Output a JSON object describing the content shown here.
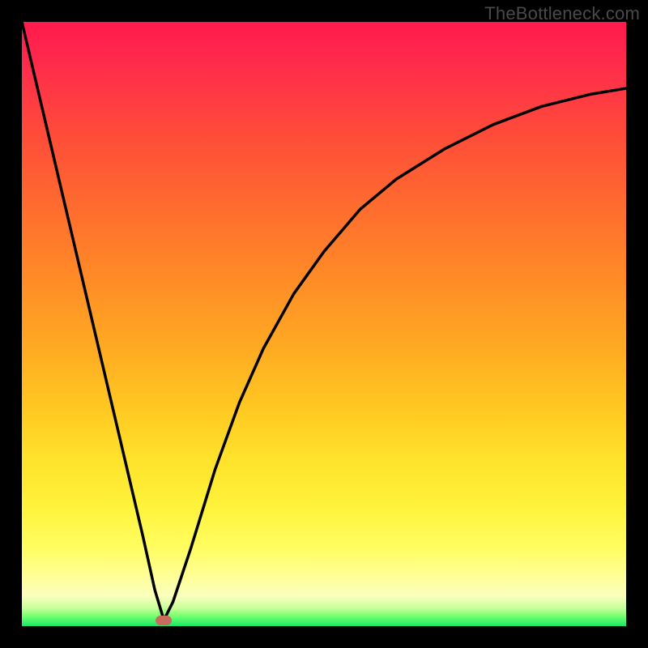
{
  "watermark": "TheBottleneck.com",
  "chart_data": {
    "type": "line",
    "title": "",
    "xlabel": "",
    "ylabel": "",
    "xlim": [
      0,
      100
    ],
    "ylim": [
      0,
      100
    ],
    "curve": {
      "x": [
        0,
        4,
        8,
        12,
        16,
        20,
        22,
        23.5,
        25,
        28,
        32,
        36,
        40,
        45,
        50,
        56,
        62,
        70,
        78,
        86,
        94,
        100
      ],
      "y": [
        100,
        83,
        66,
        49,
        32,
        15,
        6,
        1,
        4,
        13,
        26,
        37,
        46,
        55,
        62,
        69,
        74,
        79,
        83,
        86,
        88,
        89
      ]
    },
    "marker": {
      "x": 23.5,
      "y": 1
    },
    "gradient_stops": [
      {
        "pos": 0,
        "color": "#ff1a4d"
      },
      {
        "pos": 0.5,
        "color": "#ffaa22"
      },
      {
        "pos": 0.85,
        "color": "#fff23a"
      },
      {
        "pos": 1.0,
        "color": "#17e66b"
      }
    ]
  }
}
